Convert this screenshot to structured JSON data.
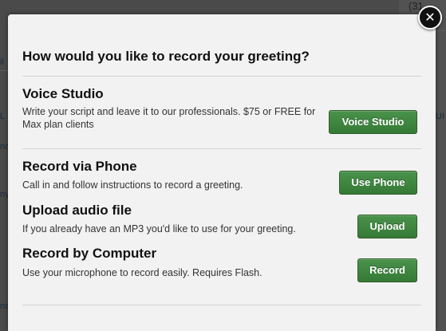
{
  "modal": {
    "title": "How would you like to record your greeting?",
    "close_symbol": "✕",
    "options": [
      {
        "title": "Voice Studio",
        "description": "Write your script and leave it to our professionals. $75 or FREE for Max plan clients",
        "button_label": "Voice Studio"
      },
      {
        "title": "Record via Phone",
        "description": "Call in and follow instructions to record a greeting.",
        "button_label": "Use Phone"
      },
      {
        "title": "Upload audio file",
        "description": "If you already have an MP3 you'd like to use for your greeting.",
        "button_label": "Upload"
      },
      {
        "title": "Record by Computer",
        "description": "Use your microphone to record easily. Requires Flash.",
        "button_label": "Record"
      }
    ]
  },
  "background": {
    "phone_fragment": "(31",
    "text_fragments": [
      "il",
      "L",
      "no",
      "ny",
      "na",
      "UI"
    ]
  },
  "colors": {
    "button_green": "#3f8740",
    "modal_background": "#f2f2f2",
    "overlay": "#3b3b3b"
  },
  "icons": {
    "close": "close-icon"
  }
}
